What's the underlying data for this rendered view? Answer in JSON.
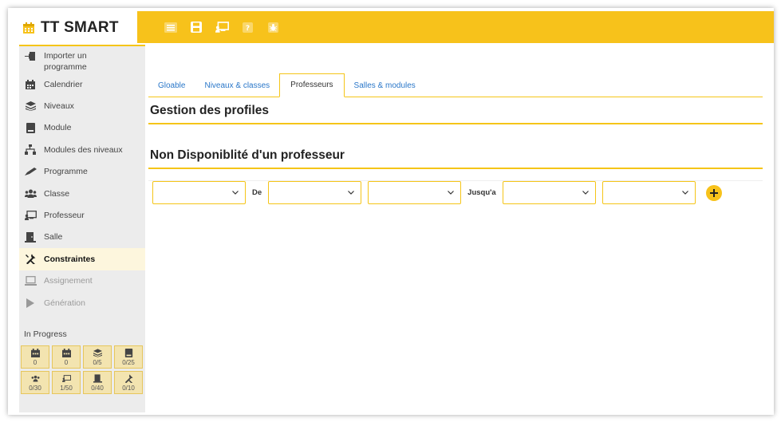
{
  "app": {
    "brand": "TT SMART"
  },
  "sidebar": {
    "items": [
      {
        "label": "Importer un programme",
        "icon": "import-icon"
      },
      {
        "label": "Calendrier",
        "icon": "calendar-icon"
      },
      {
        "label": "Niveaux",
        "icon": "layers-icon"
      },
      {
        "label": "Module",
        "icon": "book-icon"
      },
      {
        "label": "Modules des niveaux",
        "icon": "sitemap-icon"
      },
      {
        "label": "Programme",
        "icon": "pen-icon"
      },
      {
        "label": "Classe",
        "icon": "users-icon"
      },
      {
        "label": "Professeur",
        "icon": "teacher-icon"
      },
      {
        "label": "Salle",
        "icon": "room-icon"
      },
      {
        "label": "Constraintes",
        "icon": "tools-icon"
      },
      {
        "label": "Assignement",
        "icon": "laptop-icon"
      },
      {
        "label": "Génération",
        "icon": "play-icon"
      }
    ],
    "active": "Constraintes",
    "progress_title": "In Progress",
    "progress": [
      {
        "icon": "calendar-icon",
        "value": "0"
      },
      {
        "icon": "calendar-icon",
        "value": "0"
      },
      {
        "icon": "layers-icon",
        "value": "0/5"
      },
      {
        "icon": "book-icon",
        "value": "0/25"
      },
      {
        "icon": "users-icon",
        "value": "0/30"
      },
      {
        "icon": "teacher-icon",
        "value": "1/50"
      },
      {
        "icon": "room-icon",
        "value": "0/40"
      },
      {
        "icon": "tools-icon",
        "value": "0/10"
      }
    ]
  },
  "toolbar": {
    "buttons": [
      "menu-icon",
      "save-icon",
      "teacher-icon",
      "help-icon",
      "bug-icon"
    ]
  },
  "tabs": [
    {
      "label": "Gloable"
    },
    {
      "label": "Niveaux & classes"
    },
    {
      "label": "Professeurs"
    },
    {
      "label": "Salles & modules"
    }
  ],
  "active_tab": "Professeurs",
  "main": {
    "profiles_title": "Gestion des profiles",
    "unavailability_title": "Non Disponiblité d'un professeur",
    "label_from": "De",
    "label_to": "Jusqu'a"
  },
  "colors": {
    "accent": "#f7c21b",
    "link": "#2a77c9",
    "sidebar_bg": "#ececec"
  }
}
